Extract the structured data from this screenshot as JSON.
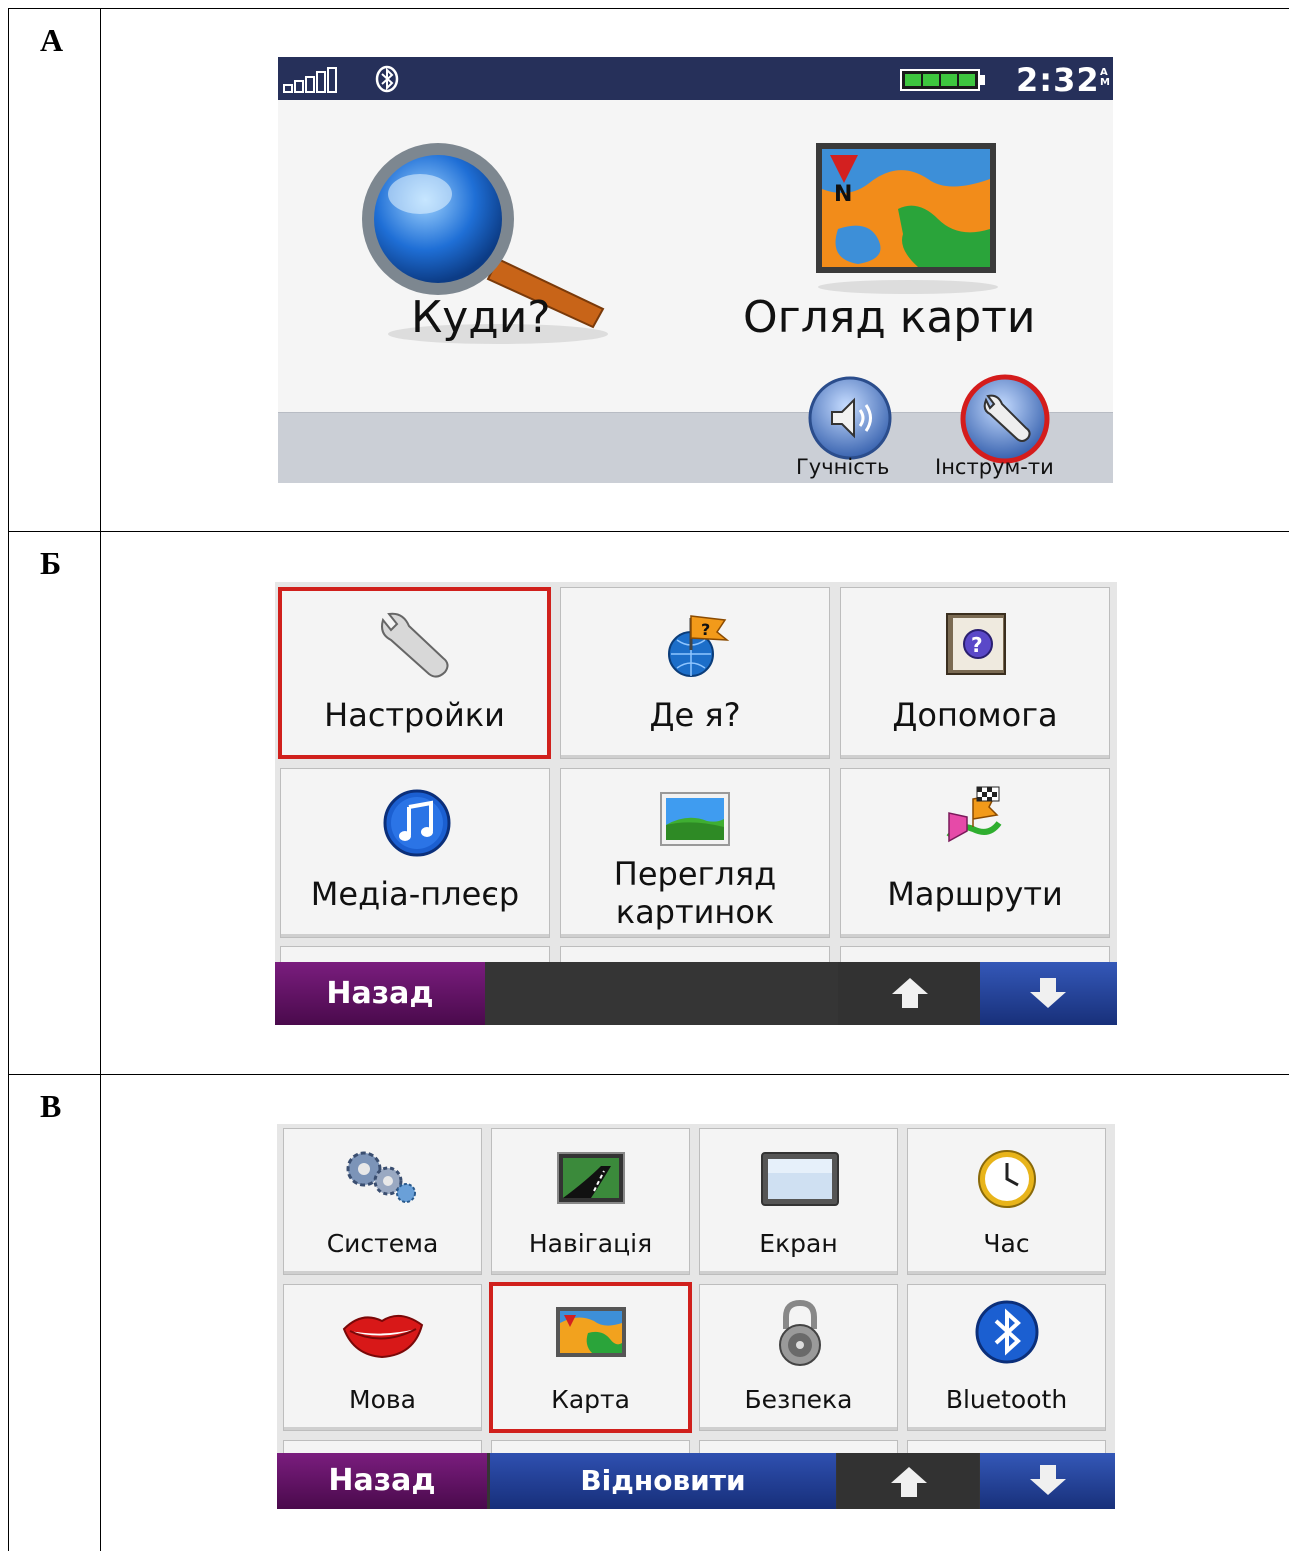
{
  "rows": [
    "А",
    "Б",
    "В"
  ],
  "screen_a": {
    "time": "2:32",
    "time_suffix": "AM",
    "where_to": "Куди?",
    "view_map": "Огляд карти",
    "volume": "Гучність",
    "tools": "Інструм-ти",
    "map_north_letter": "N"
  },
  "screen_b": {
    "tiles": [
      "Настройки",
      "Де я?",
      "Допомога",
      "Медіа-плеєр",
      "Перегляд",
      "картинок",
      "Маршрути"
    ],
    "back": "Назад"
  },
  "screen_c": {
    "tiles": [
      "Система",
      "Навігація",
      "Екран",
      "Час",
      "Мова",
      "Карта",
      "Безпека",
      "Bluetooth"
    ],
    "back": "Назад",
    "restore": "Відновити"
  },
  "colors": {
    "status_bar": "#26305a",
    "selection": "#d0201c",
    "back_button": "#5a1060",
    "blue_button": "#1f3a8f"
  }
}
